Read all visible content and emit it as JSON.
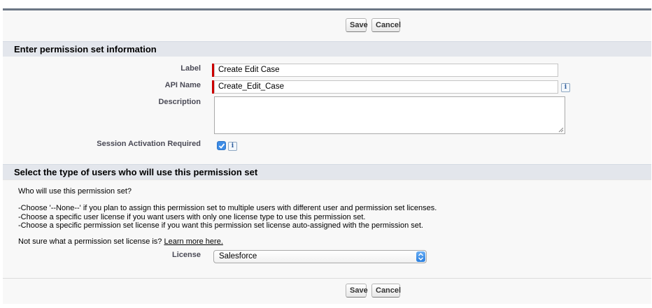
{
  "buttons": {
    "save_label": "Save",
    "cancel_label": "Cancel"
  },
  "section1": {
    "title": "Enter permission set information",
    "label_field": {
      "label": "Label",
      "value": "Create Edit Case"
    },
    "api_name_field": {
      "label": "API Name",
      "value": "Create_Edit_Case"
    },
    "description_field": {
      "label": "Description",
      "value": ""
    },
    "session_activation": {
      "label": "Session Activation Required",
      "checked": true
    }
  },
  "section2": {
    "title": "Select the type of users who will use this permission set",
    "question": "Who will use this permission set?",
    "bullets": [
      "-Choose '--None--' if you plan to assign this permission set to multiple users with different user and permission set licenses.",
      "-Choose a specific user license if you want users with only one license type to use this permission set.",
      "-Choose a specific permission set license if you want this permission set license auto-assigned with the permission set."
    ],
    "not_sure_text": "Not sure what a permission set license is?",
    "learn_more_link": "Learn more here.",
    "license_label": "License",
    "license_selected": "Salesforce"
  },
  "icons": {
    "info": "i"
  },
  "colors": {
    "required_bar": "#cc0000",
    "checkbox": "#3d8ce6",
    "section_header_bg": "#e3e6ec",
    "frame_top_border": "#6b7685"
  }
}
